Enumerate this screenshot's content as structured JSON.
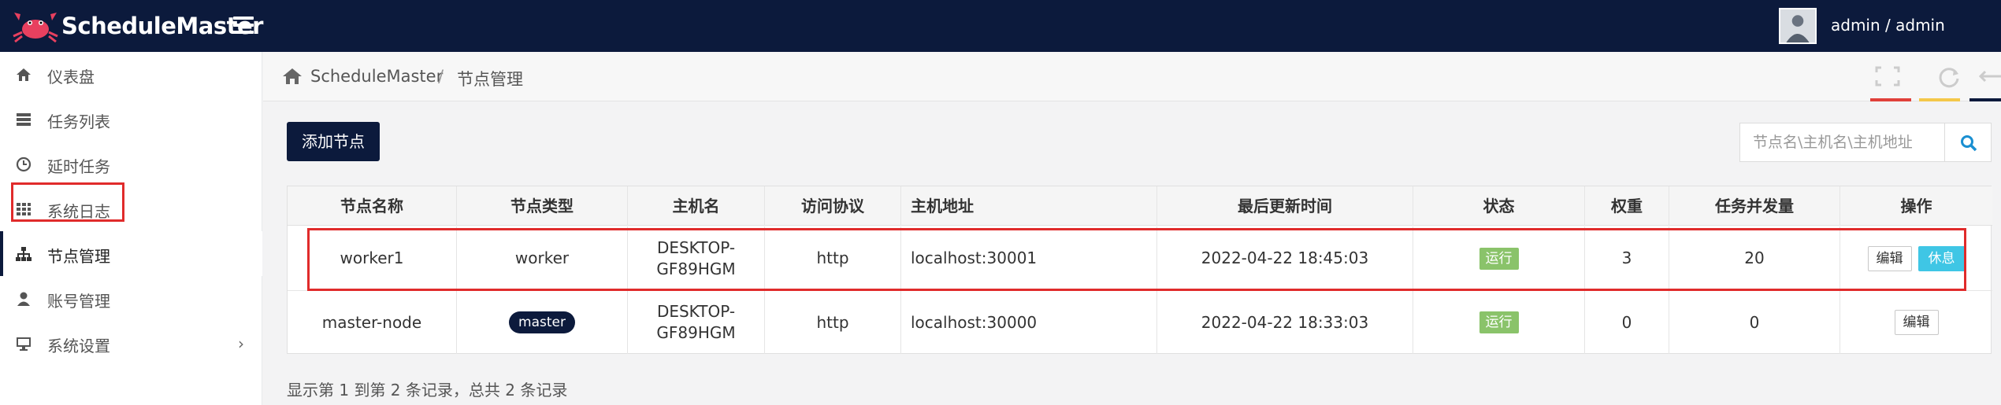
{
  "app": {
    "brand": "ScheduleMaster",
    "user": "admin / admin"
  },
  "sidebar": {
    "items": [
      {
        "label": "仪表盘",
        "icon": "home-icon"
      },
      {
        "label": "任务列表",
        "icon": "list-icon"
      },
      {
        "label": "延时任务",
        "icon": "clock-icon"
      },
      {
        "label": "系统日志",
        "icon": "grid-icon"
      },
      {
        "label": "节点管理",
        "icon": "sitemap-icon",
        "active": true
      },
      {
        "label": "账号管理",
        "icon": "user-icon"
      },
      {
        "label": "系统设置",
        "icon": "monitor-icon",
        "chevron": "›"
      }
    ]
  },
  "breadcrumb": {
    "root": "ScheduleMaster",
    "separator": "/",
    "current": "节点管理"
  },
  "toolbar": {
    "add_label": "添加节点",
    "search_placeholder": "节点名\\主机名\\主机地址"
  },
  "table": {
    "headers": [
      "节点名称",
      "节点类型",
      "主机名",
      "访问协议",
      "主机地址",
      "最后更新时间",
      "状态",
      "权重",
      "任务并发量",
      "操作"
    ],
    "rows": [
      {
        "name": "worker1",
        "type": "worker",
        "host": "DESKTOP-GF89HGM",
        "protocol": "http",
        "address": "localhost:30001",
        "updated": "2022-04-22 18:45:03",
        "status": "运行",
        "weight": "3",
        "concurrency": "20",
        "actions": [
          "编辑",
          "休息"
        ]
      },
      {
        "name": "master-node",
        "type": "master",
        "host": "DESKTOP-GF89HGM",
        "protocol": "http",
        "address": "localhost:30000",
        "updated": "2022-04-22 18:33:03",
        "status": "运行",
        "weight": "0",
        "concurrency": "0",
        "actions": [
          "编辑"
        ]
      }
    ]
  },
  "footer": {
    "info": "显示第 1 到第 2 条记录，总共 2 条记录"
  },
  "colors": {
    "navy": "#0c1a3c",
    "status_green": "#8ac36a",
    "rest_blue": "#3fc6e5",
    "highlight_red": "#e02b2b",
    "tool_red": "#e0403a",
    "tool_yellow": "#f4c84a"
  }
}
